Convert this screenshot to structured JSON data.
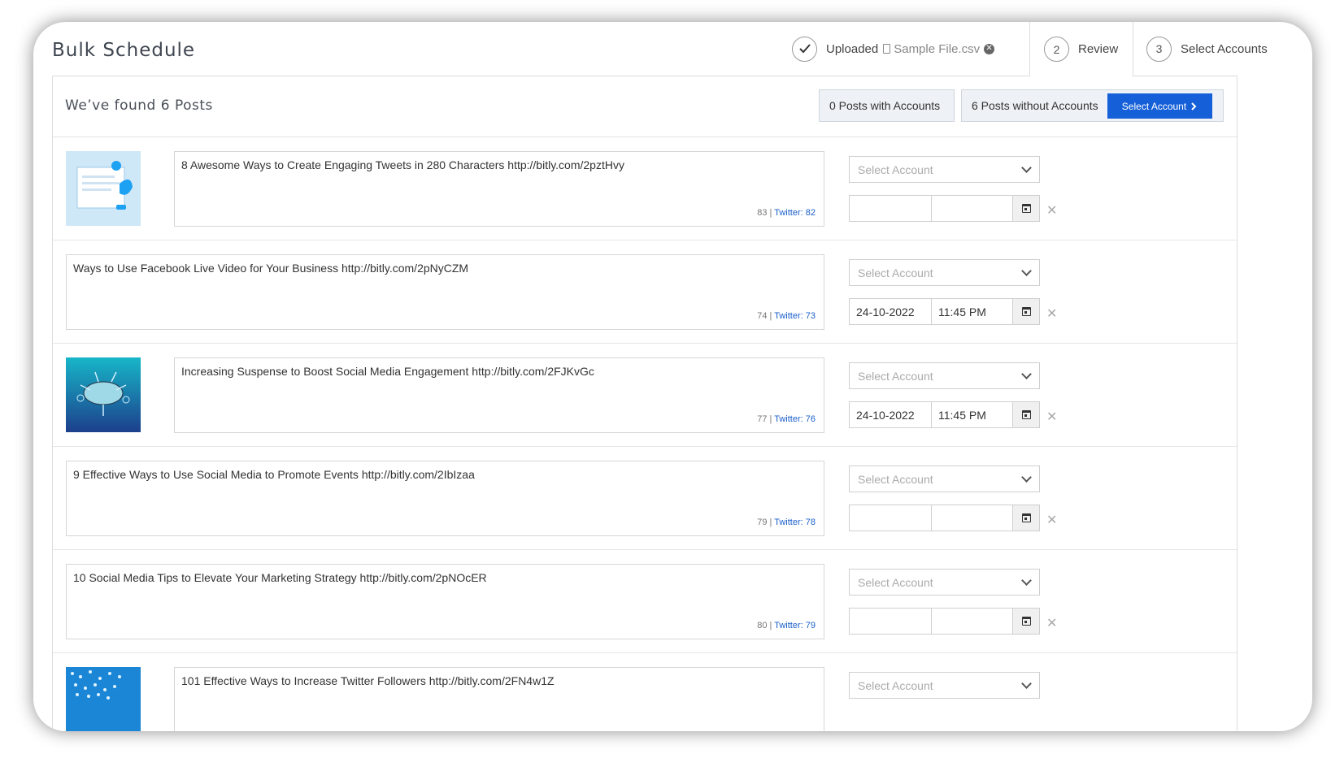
{
  "page_title": "Bulk Schedule",
  "steps": {
    "uploaded_label": "Uploaded",
    "file_name": "Sample File.csv",
    "review_number": "2",
    "review_label": "Review",
    "select_number": "3",
    "select_label": "Select Accounts"
  },
  "summary": {
    "found_text": "We’ve found 6 Posts",
    "with_accounts": "0 Posts with Accounts",
    "without_accounts": "6 Posts without Accounts",
    "select_account_btn": "Select Account"
  },
  "account_placeholder": "Select Account",
  "twitter_prefix": "Twitter: ",
  "posts": [
    {
      "text": "8 Awesome Ways to Create Engaging Tweets in 280 Characters http://bitly.com/2pztHvy",
      "count": "83",
      "twitter": "82",
      "date": "",
      "time": "",
      "has_image": true
    },
    {
      "text": "Ways to Use Facebook Live Video for Your Business http://bitly.com/2pNyCZM",
      "count": "74",
      "twitter": "73",
      "date": "24-10-2022",
      "time": "11:45 PM",
      "has_image": false
    },
    {
      "text": "Increasing Suspense to Boost Social Media Engagement http://bitly.com/2FJKvGc",
      "count": "77",
      "twitter": "76",
      "date": "24-10-2022",
      "time": "11:45 PM",
      "has_image": true
    },
    {
      "text": "9 Effective Ways to Use Social Media to Promote Events http://bitly.com/2IbIzaa",
      "count": "79",
      "twitter": "78",
      "date": "",
      "time": "",
      "has_image": false
    },
    {
      "text": "10 Social Media Tips to Elevate Your Marketing Strategy http://bitly.com/2pNOcER",
      "count": "80",
      "twitter": "79",
      "date": "",
      "time": "",
      "has_image": false
    },
    {
      "text": "101 Effective Ways to Increase Twitter Followers http://bitly.com/2FN4w1Z",
      "count": "",
      "twitter": "",
      "date": "",
      "time": "",
      "has_image": true
    }
  ],
  "colors": {
    "primary_button": "#1560d8",
    "link_twitter": "#1a5fc9",
    "pill_background": "#eef1f5"
  }
}
